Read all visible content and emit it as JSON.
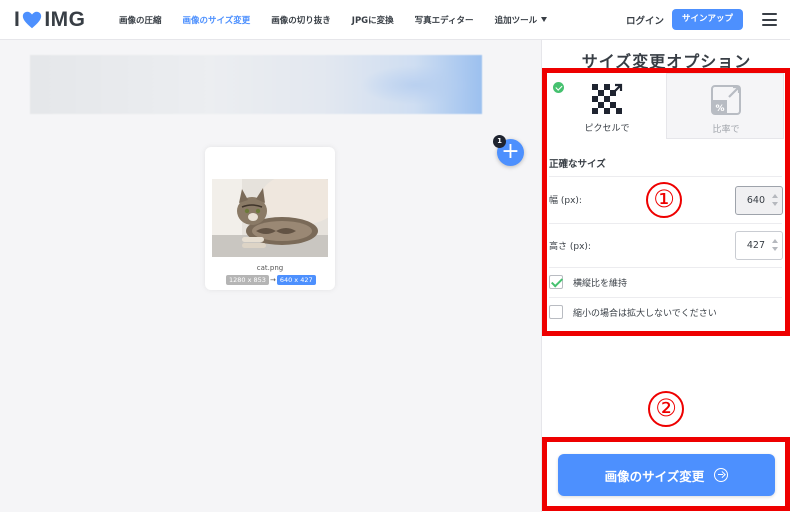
{
  "header": {
    "logo_left": "I",
    "logo_right": "IMG",
    "nav": [
      {
        "label": "画像の圧縮"
      },
      {
        "label": "画像のサイズ変更",
        "active": true
      },
      {
        "label": "画像の切り抜き"
      },
      {
        "label": "JPGに変換"
      },
      {
        "label": "写真エディター"
      },
      {
        "label": "追加ツール"
      }
    ],
    "login_label": "ログイン",
    "signup_label": "サインアップ"
  },
  "workspace": {
    "file": {
      "name": "cat.png",
      "original_size": "1280 x 853",
      "arrow": "→",
      "new_size": "640 x 427"
    },
    "add_button_symbol": "+",
    "file_count": "1"
  },
  "sidebar": {
    "title": "サイズ変更オプション",
    "tabs": [
      {
        "label": "ピクセルで",
        "selected": true
      },
      {
        "label": "比率で",
        "selected": false
      }
    ],
    "section_label": "正確なサイズ",
    "width": {
      "label": "幅 (px):",
      "value": "640"
    },
    "height": {
      "label": "高さ (px):",
      "value": "427"
    },
    "keep_ratio": {
      "label": "横縦比を維持",
      "checked": true
    },
    "no_enlarge": {
      "label": "縮小の場合は拡大しないでください",
      "checked": false
    },
    "submit_label": "画像のサイズ変更"
  },
  "annotations": {
    "one": "①",
    "two": "②"
  },
  "colors": {
    "accent": "#4d90fe",
    "annotation": "#ee0000",
    "check": "#45c16f",
    "text_dark": "#383e45"
  }
}
